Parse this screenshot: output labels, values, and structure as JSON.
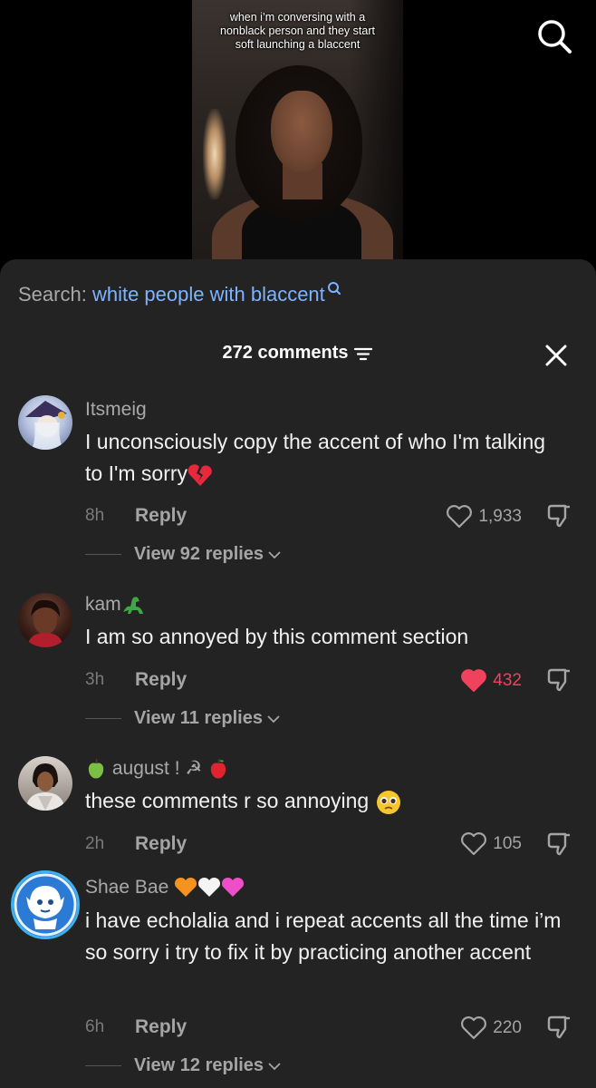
{
  "video": {
    "caption": "when i’m conversing with a nonblack person and they start soft launching a blaccent"
  },
  "search": {
    "prefix": "Search:",
    "query": "white people with blaccent"
  },
  "comments_header": {
    "count_label": "272 comments"
  },
  "comments": [
    {
      "username": "Itsmeig",
      "text": "I unconsciously copy the accent of who I'm talking to I'm sorry",
      "emoji": "broken-heart",
      "time": "8h",
      "reply_label": "Reply",
      "likes": "1,933",
      "liked": false,
      "view_replies": "View 92 replies"
    },
    {
      "username": "kam",
      "username_emoji": "dinosaur",
      "text": "I am so annoyed by this comment section",
      "time": "3h",
      "reply_label": "Reply",
      "likes": "432",
      "liked": true,
      "view_replies": "View 11 replies"
    },
    {
      "username": "august ! ☭",
      "username_emoji_left": "green-apple",
      "username_emoji_right": "red-apple",
      "text": "these comments r so annoying",
      "emoji": "pleading-face",
      "time": "2h",
      "reply_label": "Reply",
      "likes": "105",
      "liked": false
    },
    {
      "username": "Shae Bae",
      "username_emojis": [
        "orange-heart",
        "white-heart",
        "pink-heart"
      ],
      "text": "i have echolalia and i repeat accents all the time i’m so sorry i try to fix it by practicing another accent",
      "time": "6h",
      "reply_label": "Reply",
      "likes": "220",
      "liked": false,
      "view_replies": "View 12 replies"
    }
  ],
  "colors": {
    "sheet_bg": "#232323",
    "search_query": "#7fb3ff",
    "liked": "#f0425d",
    "muted": "#a5a5a5"
  }
}
